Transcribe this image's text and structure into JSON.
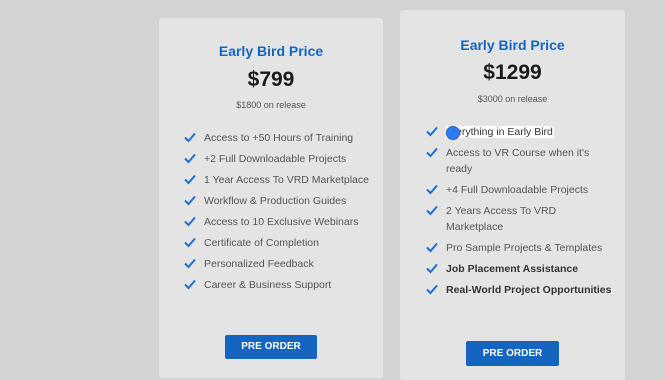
{
  "plans": [
    {
      "title": "Early Bird Price",
      "price": "$799",
      "release": "$1800 on release",
      "features": [
        {
          "text": "Access to +50 Hours of Training",
          "bold": false
        },
        {
          "text": "+2 Full Downloadable Projects",
          "bold": false
        },
        {
          "text": "1 Year Access To VRD Marketplace",
          "bold": false
        },
        {
          "text": "Workflow & Production Guides",
          "bold": false
        },
        {
          "text": "Access to 10 Exclusive Webinars",
          "bold": false
        },
        {
          "text": "Certificate of Completion",
          "bold": false
        },
        {
          "text": "Personalized Feedback",
          "bold": false
        },
        {
          "text": "Career & Business Support",
          "bold": false
        }
      ],
      "button": "PRE ORDER"
    },
    {
      "title": "Early Bird Price",
      "price": "$1299",
      "release": "$3000 on release",
      "features": [
        {
          "text": "erything in Early Bird",
          "bold": false
        },
        {
          "text": "Access to VR Course when it's ready",
          "bold": false
        },
        {
          "text": "+4 Full Downloadable Projects",
          "bold": false
        },
        {
          "text": "2 Years Access To VRD Marketplace",
          "bold": false
        },
        {
          "text": "Pro Sample Projects & Templates",
          "bold": false
        },
        {
          "text": "Job Placement Assistance",
          "bold": true
        },
        {
          "text": "Real-World Project Opportunities",
          "bold": true
        }
      ],
      "button": "PRE ORDER"
    }
  ],
  "colors": {
    "accent": "#1565c0",
    "check": "#1e6fd0"
  },
  "icons": {
    "check": "check-icon",
    "cursor": "cursor-dot-icon"
  }
}
